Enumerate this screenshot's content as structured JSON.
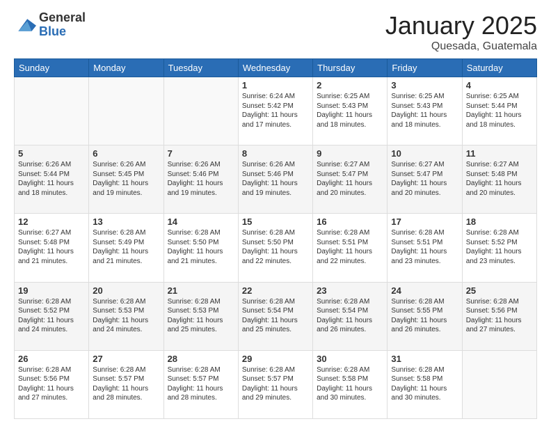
{
  "header": {
    "logo_general": "General",
    "logo_blue": "Blue",
    "month_title": "January 2025",
    "location": "Quesada, Guatemala"
  },
  "weekdays": [
    "Sunday",
    "Monday",
    "Tuesday",
    "Wednesday",
    "Thursday",
    "Friday",
    "Saturday"
  ],
  "weeks": [
    [
      {
        "day": "",
        "info": ""
      },
      {
        "day": "",
        "info": ""
      },
      {
        "day": "",
        "info": ""
      },
      {
        "day": "1",
        "info": "Sunrise: 6:24 AM\nSunset: 5:42 PM\nDaylight: 11 hours\nand 17 minutes."
      },
      {
        "day": "2",
        "info": "Sunrise: 6:25 AM\nSunset: 5:43 PM\nDaylight: 11 hours\nand 18 minutes."
      },
      {
        "day": "3",
        "info": "Sunrise: 6:25 AM\nSunset: 5:43 PM\nDaylight: 11 hours\nand 18 minutes."
      },
      {
        "day": "4",
        "info": "Sunrise: 6:25 AM\nSunset: 5:44 PM\nDaylight: 11 hours\nand 18 minutes."
      }
    ],
    [
      {
        "day": "5",
        "info": "Sunrise: 6:26 AM\nSunset: 5:44 PM\nDaylight: 11 hours\nand 18 minutes."
      },
      {
        "day": "6",
        "info": "Sunrise: 6:26 AM\nSunset: 5:45 PM\nDaylight: 11 hours\nand 19 minutes."
      },
      {
        "day": "7",
        "info": "Sunrise: 6:26 AM\nSunset: 5:46 PM\nDaylight: 11 hours\nand 19 minutes."
      },
      {
        "day": "8",
        "info": "Sunrise: 6:26 AM\nSunset: 5:46 PM\nDaylight: 11 hours\nand 19 minutes."
      },
      {
        "day": "9",
        "info": "Sunrise: 6:27 AM\nSunset: 5:47 PM\nDaylight: 11 hours\nand 20 minutes."
      },
      {
        "day": "10",
        "info": "Sunrise: 6:27 AM\nSunset: 5:47 PM\nDaylight: 11 hours\nand 20 minutes."
      },
      {
        "day": "11",
        "info": "Sunrise: 6:27 AM\nSunset: 5:48 PM\nDaylight: 11 hours\nand 20 minutes."
      }
    ],
    [
      {
        "day": "12",
        "info": "Sunrise: 6:27 AM\nSunset: 5:48 PM\nDaylight: 11 hours\nand 21 minutes."
      },
      {
        "day": "13",
        "info": "Sunrise: 6:28 AM\nSunset: 5:49 PM\nDaylight: 11 hours\nand 21 minutes."
      },
      {
        "day": "14",
        "info": "Sunrise: 6:28 AM\nSunset: 5:50 PM\nDaylight: 11 hours\nand 21 minutes."
      },
      {
        "day": "15",
        "info": "Sunrise: 6:28 AM\nSunset: 5:50 PM\nDaylight: 11 hours\nand 22 minutes."
      },
      {
        "day": "16",
        "info": "Sunrise: 6:28 AM\nSunset: 5:51 PM\nDaylight: 11 hours\nand 22 minutes."
      },
      {
        "day": "17",
        "info": "Sunrise: 6:28 AM\nSunset: 5:51 PM\nDaylight: 11 hours\nand 23 minutes."
      },
      {
        "day": "18",
        "info": "Sunrise: 6:28 AM\nSunset: 5:52 PM\nDaylight: 11 hours\nand 23 minutes."
      }
    ],
    [
      {
        "day": "19",
        "info": "Sunrise: 6:28 AM\nSunset: 5:52 PM\nDaylight: 11 hours\nand 24 minutes."
      },
      {
        "day": "20",
        "info": "Sunrise: 6:28 AM\nSunset: 5:53 PM\nDaylight: 11 hours\nand 24 minutes."
      },
      {
        "day": "21",
        "info": "Sunrise: 6:28 AM\nSunset: 5:53 PM\nDaylight: 11 hours\nand 25 minutes."
      },
      {
        "day": "22",
        "info": "Sunrise: 6:28 AM\nSunset: 5:54 PM\nDaylight: 11 hours\nand 25 minutes."
      },
      {
        "day": "23",
        "info": "Sunrise: 6:28 AM\nSunset: 5:54 PM\nDaylight: 11 hours\nand 26 minutes."
      },
      {
        "day": "24",
        "info": "Sunrise: 6:28 AM\nSunset: 5:55 PM\nDaylight: 11 hours\nand 26 minutes."
      },
      {
        "day": "25",
        "info": "Sunrise: 6:28 AM\nSunset: 5:56 PM\nDaylight: 11 hours\nand 27 minutes."
      }
    ],
    [
      {
        "day": "26",
        "info": "Sunrise: 6:28 AM\nSunset: 5:56 PM\nDaylight: 11 hours\nand 27 minutes."
      },
      {
        "day": "27",
        "info": "Sunrise: 6:28 AM\nSunset: 5:57 PM\nDaylight: 11 hours\nand 28 minutes."
      },
      {
        "day": "28",
        "info": "Sunrise: 6:28 AM\nSunset: 5:57 PM\nDaylight: 11 hours\nand 28 minutes."
      },
      {
        "day": "29",
        "info": "Sunrise: 6:28 AM\nSunset: 5:57 PM\nDaylight: 11 hours\nand 29 minutes."
      },
      {
        "day": "30",
        "info": "Sunrise: 6:28 AM\nSunset: 5:58 PM\nDaylight: 11 hours\nand 30 minutes."
      },
      {
        "day": "31",
        "info": "Sunrise: 6:28 AM\nSunset: 5:58 PM\nDaylight: 11 hours\nand 30 minutes."
      },
      {
        "day": "",
        "info": ""
      }
    ]
  ]
}
